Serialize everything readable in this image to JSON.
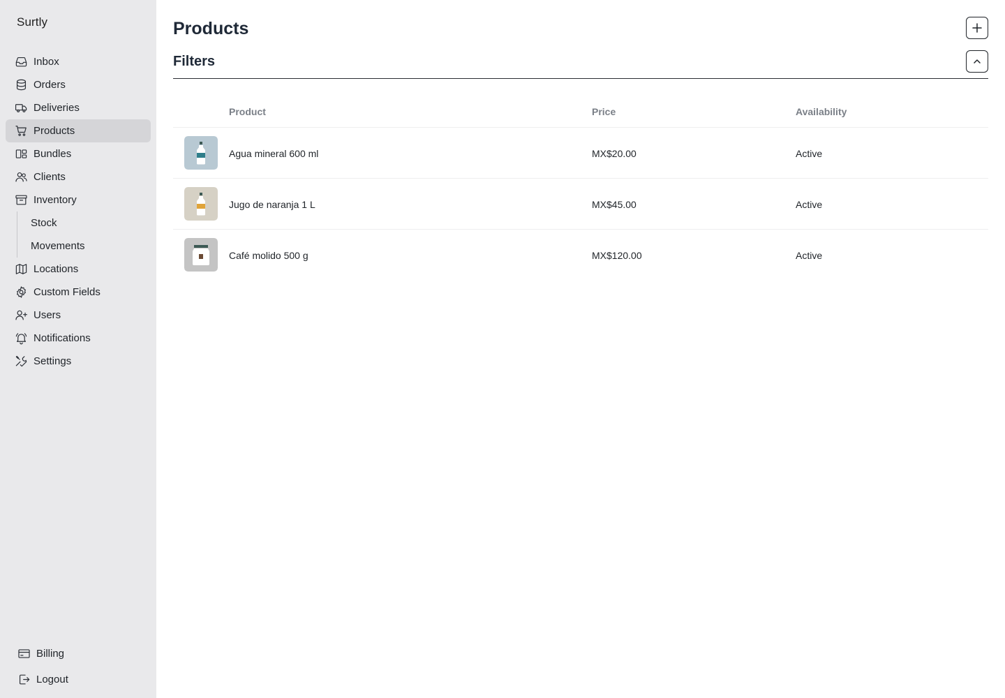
{
  "app": {
    "brand": "Surtly"
  },
  "sidebar": {
    "items": [
      {
        "label": "Inbox",
        "icon": "inbox-icon"
      },
      {
        "label": "Orders",
        "icon": "database-icon"
      },
      {
        "label": "Deliveries",
        "icon": "truck-icon"
      },
      {
        "label": "Products",
        "icon": "cart-icon",
        "active": true
      },
      {
        "label": "Bundles",
        "icon": "bundles-icon"
      },
      {
        "label": "Clients",
        "icon": "users-icon"
      },
      {
        "label": "Inventory",
        "icon": "archive-icon"
      }
    ],
    "inventory_sub": [
      {
        "label": "Stock"
      },
      {
        "label": "Movements"
      }
    ],
    "items_after": [
      {
        "label": "Locations",
        "icon": "map-icon"
      },
      {
        "label": "Custom Fields",
        "icon": "cog-icon"
      },
      {
        "label": "Users",
        "icon": "user-plus-icon"
      },
      {
        "label": "Notifications",
        "icon": "bell-icon"
      },
      {
        "label": "Settings",
        "icon": "wrench-icon"
      }
    ],
    "bottom": [
      {
        "label": "Billing",
        "icon": "credit-card-icon"
      },
      {
        "label": "Logout",
        "icon": "logout-icon"
      }
    ]
  },
  "main": {
    "title": "Products",
    "add_icon": "plus-icon",
    "filters": {
      "title": "Filters",
      "toggle_icon": "chevron-up-icon"
    },
    "table": {
      "columns": [
        "Product",
        "Price",
        "Availability"
      ],
      "rows": [
        {
          "name": "Agua mineral 600 ml",
          "price": "MX$20.00",
          "availability": "Active",
          "thumb_bg": "#b8c9d3",
          "accent": "#2f7e8a"
        },
        {
          "name": "Jugo de naranja 1 L",
          "price": "MX$45.00",
          "availability": "Active",
          "thumb_bg": "#d6d1c5",
          "accent": "#e0a43a"
        },
        {
          "name": "Café molido 500 g",
          "price": "MX$120.00",
          "availability": "Active",
          "thumb_bg": "#c4c4c4",
          "accent": "#6b4a34"
        }
      ]
    }
  },
  "colors": {
    "sidebar_bg": "#e9e9eb",
    "active_item_bg": "#d5d5d8",
    "header_text": "#7a7f87"
  }
}
